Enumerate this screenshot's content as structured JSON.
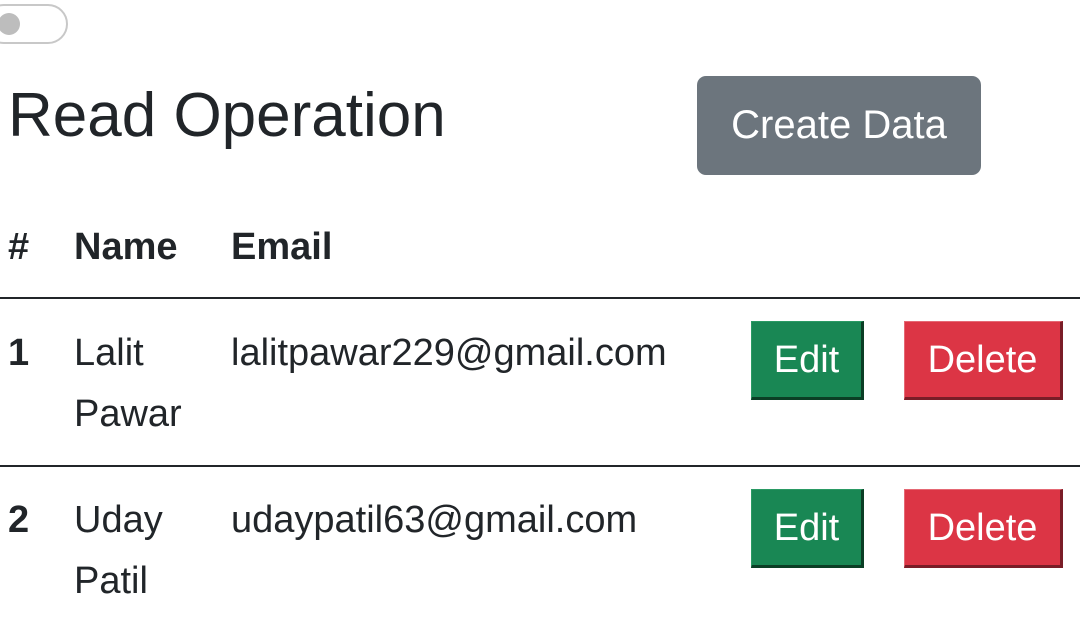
{
  "toggle": {
    "state": "off"
  },
  "header": {
    "title": "Read Operation",
    "create_label": "Create Data"
  },
  "table": {
    "columns": [
      "#",
      "Name",
      "Email"
    ],
    "rows": [
      {
        "id": "1",
        "name_line1": "Lalit",
        "name_line2": "Pawar",
        "email": "lalitpawar229@gmail.com",
        "edit_label": "Edit",
        "delete_label": "Delete"
      },
      {
        "id": "2",
        "name_line1": "Uday",
        "name_line2": "Patil",
        "email": "udaypatil63@gmail.com",
        "edit_label": "Edit",
        "delete_label": "Delete"
      }
    ]
  },
  "colors": {
    "secondary": "#6c757d",
    "success": "#198754",
    "danger": "#dc3545",
    "text": "#212529"
  }
}
